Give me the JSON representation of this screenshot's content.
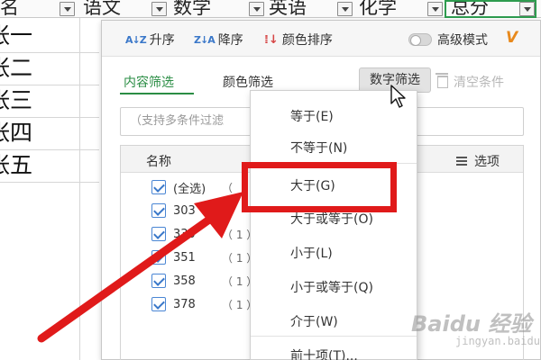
{
  "sheet": {
    "headers": [
      {
        "label": "名"
      },
      {
        "label": "语文"
      },
      {
        "label": "数学"
      },
      {
        "label": "英语"
      },
      {
        "label": "化学"
      },
      {
        "label": "总分"
      }
    ],
    "names": [
      "张一",
      "张二",
      "张三",
      "张四",
      "张五"
    ]
  },
  "toolbar": {
    "sort_asc": "升序",
    "sort_desc": "降序",
    "color_sort": "颜色排序",
    "advanced_mode": "高级模式"
  },
  "tabs": {
    "content_filter": "内容筛选",
    "color_filter": "颜色筛选",
    "number_filter": "数字筛选",
    "clear_conditions": "清空条件"
  },
  "search": {
    "placeholder": "（支持多条件过滤"
  },
  "list": {
    "header": "名称",
    "options_label": "选项",
    "items": [
      {
        "label": "(全选)",
        "count": "（"
      },
      {
        "label": "303",
        "count": "（"
      },
      {
        "label": "330",
        "count": "（ 1 ）"
      },
      {
        "label": "351",
        "count": "（ 1 ）"
      },
      {
        "label": "358",
        "count": "（ 1 ）"
      },
      {
        "label": "378",
        "count": "（ 1 ）"
      }
    ]
  },
  "menu": {
    "items": [
      "等于(E)",
      "不等于(N)",
      "大于(G)",
      "大于或等于(O)",
      "小于(L)",
      "小于或等于(Q)",
      "介于(W)",
      "前十项(T)..."
    ],
    "highlighted": "大于(G)"
  },
  "watermark": {
    "brand": "Baidu 经验",
    "sub": "jingyan.baidu.com"
  },
  "colors": {
    "accent_green": "#2a8d44",
    "annotation_red": "#e01a1a",
    "checkbox_blue": "#3a78c9",
    "vip_orange": "#e8891c"
  }
}
